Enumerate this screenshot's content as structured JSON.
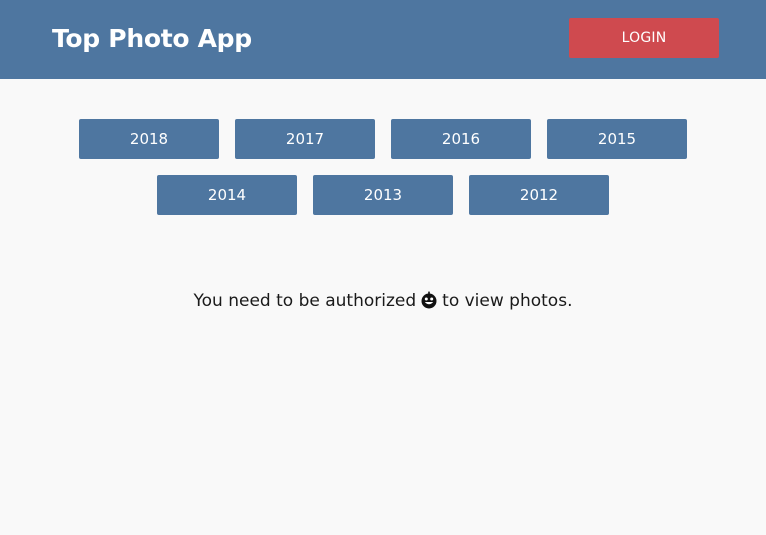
{
  "header": {
    "title": "Top Photo App",
    "login_label": "LOGIN",
    "background_color": "#4e76a0",
    "login_color": "#cf4a4f"
  },
  "year_buttons": {
    "rows": [
      [
        "2018",
        "2017",
        "2016",
        "2015"
      ],
      [
        "2014",
        "2013",
        "2012"
      ]
    ]
  },
  "message": {
    "before_icon": "You need to be authorized",
    "icon": "grinning-face-icon",
    "after_icon": "to view photos."
  }
}
